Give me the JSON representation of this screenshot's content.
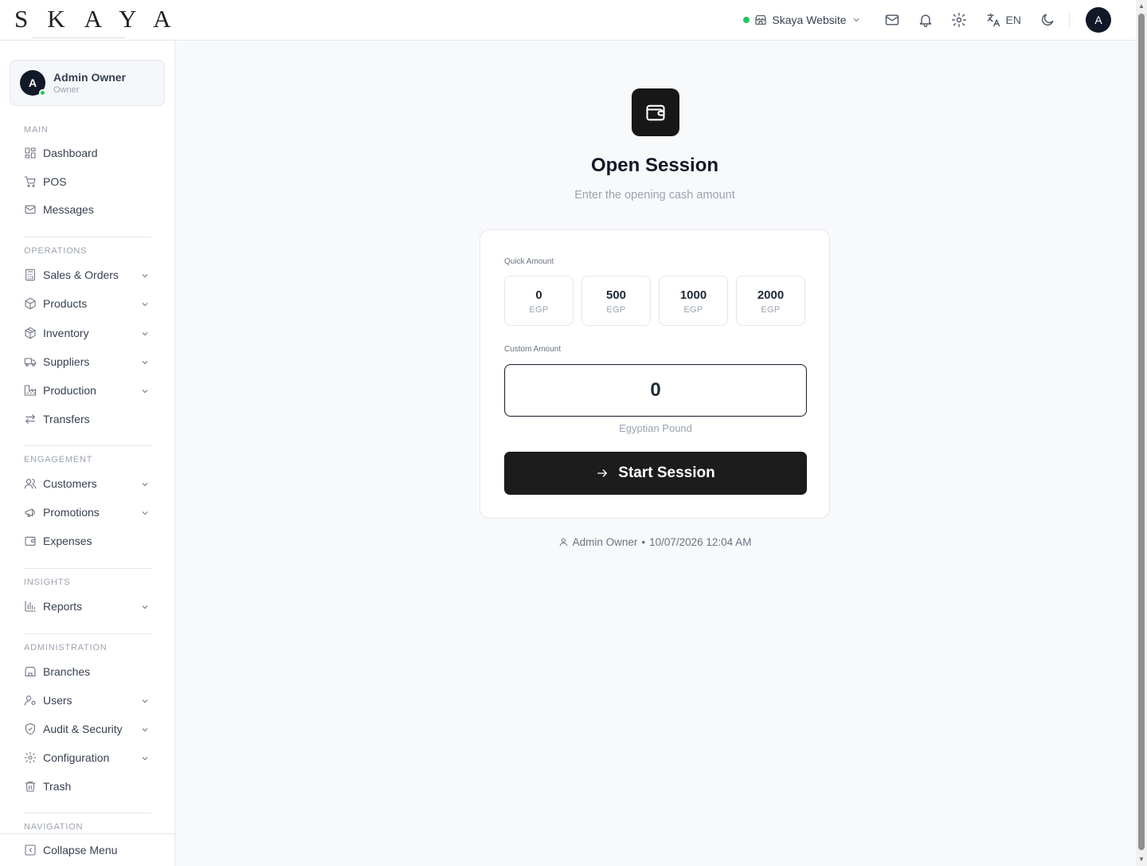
{
  "brand": {
    "logo_text": "SKAYA"
  },
  "header": {
    "store_name": "Skaya Website",
    "language": "EN",
    "avatar_initial": "A"
  },
  "sidebar": {
    "user": {
      "initial": "A",
      "name": "Admin Owner",
      "role": "Owner"
    },
    "sections": {
      "main": "MAIN",
      "operations": "OPERATIONS",
      "engagement": "ENGAGEMENT",
      "insights": "INSIGHTS",
      "administration": "ADMINISTRATION",
      "navigation": "NAVIGATION"
    },
    "items": {
      "dashboard": "Dashboard",
      "pos": "POS",
      "messages": "Messages",
      "sales_orders": "Sales & Orders",
      "products": "Products",
      "inventory": "Inventory",
      "suppliers": "Suppliers",
      "production": "Production",
      "transfers": "Transfers",
      "customers": "Customers",
      "promotions": "Promotions",
      "expenses": "Expenses",
      "reports": "Reports",
      "branches": "Branches",
      "users": "Users",
      "audit_security": "Audit & Security",
      "configuration": "Configuration",
      "trash": "Trash",
      "collapse": "Collapse Menu"
    }
  },
  "session": {
    "title": "Open Session",
    "subtitle": "Enter the opening cash amount",
    "quick_amount_label": "Quick Amount",
    "quick_amounts": [
      {
        "value": "0",
        "currency": "EGP"
      },
      {
        "value": "500",
        "currency": "EGP"
      },
      {
        "value": "1000",
        "currency": "EGP"
      },
      {
        "value": "2000",
        "currency": "EGP"
      }
    ],
    "custom_amount_label": "Custom Amount",
    "custom_amount_value": "0",
    "currency_name": "Egyptian Pound",
    "start_label": "Start Session",
    "footer_user": "Admin Owner",
    "footer_separator": "•",
    "footer_datetime": "10/07/2026 12:04 AM"
  },
  "colors": {
    "accent_dark": "#171717",
    "online_green": "#22c55e",
    "background": "#f8f9fb"
  }
}
